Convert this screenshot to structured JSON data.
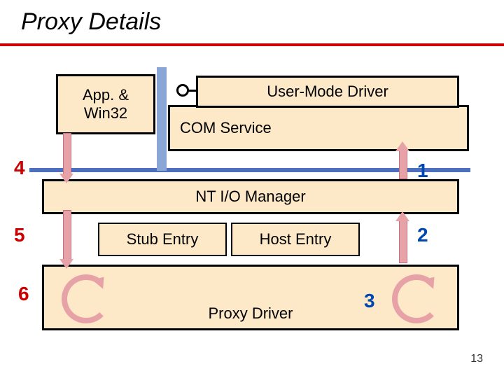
{
  "title": "Proxy Details",
  "boxes": {
    "app": "App. &\nWin32",
    "umdriver": "User-Mode Driver",
    "comsvc": "COM Service",
    "ntio": "NT I/O Manager",
    "stub": "Stub Entry",
    "host": "Host Entry",
    "proxy": "Proxy Driver"
  },
  "numbers": {
    "n1": "1",
    "n2": "2",
    "n3": "3",
    "n4": "4",
    "n5": "5",
    "n6": "6"
  },
  "page": "13"
}
